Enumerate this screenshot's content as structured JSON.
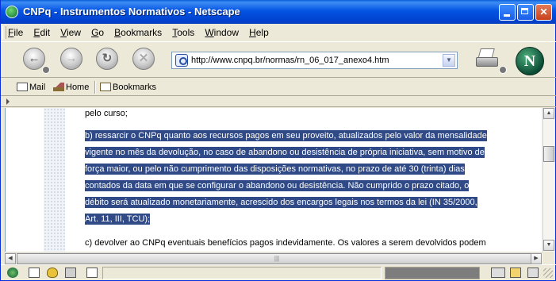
{
  "window": {
    "title": "CNPq - Instrumentos Normativos - Netscape"
  },
  "menu": [
    "File",
    "Edit",
    "View",
    "Go",
    "Bookmarks",
    "Tools",
    "Window",
    "Help"
  ],
  "menu_accel": [
    "F",
    "E",
    "V",
    "G",
    "B",
    "T",
    "W",
    "H"
  ],
  "nav": {
    "url": "http://www.cnpq.br/normas/rn_06_017_anexo4.htm",
    "buttons": [
      "back-icon",
      "forward-icon",
      "reload-icon",
      "stop-icon"
    ]
  },
  "personal_toolbar": {
    "mail": "Mail",
    "home": "Home",
    "bookmarks": "Bookmarks"
  },
  "content": {
    "line_top": "pelo curso;",
    "selected_lines": [
      "b) ressarcir o CNPq quanto aos recursos pagos em seu proveito, atualizados pelo valor da mensalidade",
      "vigente no mês da devolução, no caso de abandono ou desistência de própria iniciativa, sem motivo de",
      "força maior, ou pelo não cumprimento das disposições normativas, no prazo de até 30 (trinta) dias",
      "contados da data em que se configurar o abandono ou desistência. Não cumprido o prazo citado, o",
      "débito será atualizado monetariamente, acrescido dos encargos legais nos termos da lei (IN 35/2000,",
      "Art. 11, III, TCU);"
    ],
    "line_bottom": "c) devolver ao CNPq eventuais benefícios pagos indevidamente. Os valores a serem devolvidos podem"
  },
  "status": {
    "text": "",
    "progress": 1.0
  },
  "colors": {
    "selection": "#2f4a86",
    "titlebar": "#0554e3"
  }
}
